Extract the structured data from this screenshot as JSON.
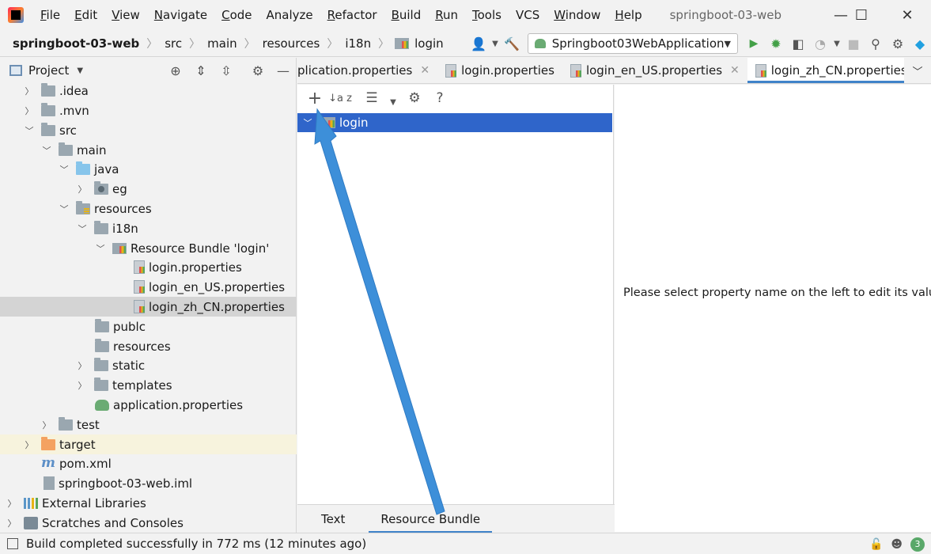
{
  "menubar": {
    "items": [
      {
        "label": "File",
        "mnemonic": "F",
        "rest": "ile"
      },
      {
        "label": "Edit",
        "mnemonic": "E",
        "rest": "dit"
      },
      {
        "label": "View",
        "mnemonic": "V",
        "rest": "iew"
      },
      {
        "label": "Navigate",
        "mnemonic": "N",
        "rest": "avigate"
      },
      {
        "label": "Code",
        "mnemonic": "C",
        "rest": "ode"
      },
      {
        "label": "Analyze",
        "mnemonic": "",
        "rest": "Analyze"
      },
      {
        "label": "Refactor",
        "mnemonic": "R",
        "rest": "efactor"
      },
      {
        "label": "Build",
        "mnemonic": "B",
        "rest": "uild"
      },
      {
        "label": "Run",
        "mnemonic": "R",
        "rest": "un"
      },
      {
        "label": "Tools",
        "mnemonic": "T",
        "rest": "ools"
      },
      {
        "label": "VCS",
        "mnemonic": "",
        "rest": "VCS"
      },
      {
        "label": "Window",
        "mnemonic": "W",
        "rest": "indow"
      },
      {
        "label": "Help",
        "mnemonic": "H",
        "rest": "elp"
      }
    ],
    "window_title": "springboot-03-web",
    "controls": {
      "minimize": "—",
      "maximize": "☐",
      "close": "✕"
    }
  },
  "navbar": {
    "breadcrumbs": [
      "springboot-03-web",
      "src",
      "main",
      "resources",
      "i18n",
      "login"
    ],
    "run_config": "Springboot03WebApplication"
  },
  "project_panel": {
    "title": "Project",
    "tree": [
      {
        "label": ".idea",
        "icon": "folder-icon",
        "expanded": false
      },
      {
        "label": ".mvn",
        "icon": "folder-icon",
        "expanded": false
      },
      {
        "label": "src",
        "icon": "folder-icon",
        "expanded": true
      },
      {
        "label": "main",
        "icon": "folder-icon",
        "expanded": true
      },
      {
        "label": "java",
        "icon": "source-folder-icon",
        "expanded": true
      },
      {
        "label": "eg",
        "icon": "package-icon",
        "expanded": false
      },
      {
        "label": "resources",
        "icon": "resources-folder-icon",
        "expanded": true
      },
      {
        "label": "i18n",
        "icon": "folder-icon",
        "expanded": true
      },
      {
        "label": "Resource Bundle 'login'",
        "icon": "resource-bundle-icon",
        "expanded": true
      },
      {
        "label": "login.properties",
        "icon": "properties-file-icon"
      },
      {
        "label": "login_en_US.properties",
        "icon": "properties-file-icon"
      },
      {
        "label": "login_zh_CN.properties",
        "icon": "properties-file-icon",
        "selected": true
      },
      {
        "label": "publc",
        "icon": "folder-icon"
      },
      {
        "label": "resources",
        "icon": "folder-icon"
      },
      {
        "label": "static",
        "icon": "folder-icon",
        "expanded": false
      },
      {
        "label": "templates",
        "icon": "folder-icon",
        "expanded": false
      },
      {
        "label": "application.properties",
        "icon": "spring-properties-icon"
      },
      {
        "label": "test",
        "icon": "folder-icon",
        "expanded": false
      },
      {
        "label": "target",
        "icon": "excluded-folder-icon",
        "expanded": false
      },
      {
        "label": "pom.xml",
        "icon": "maven-icon"
      },
      {
        "label": "springboot-03-web.iml",
        "icon": "iml-file-icon"
      },
      {
        "label": "External Libraries",
        "icon": "libraries-icon",
        "expanded": false
      },
      {
        "label": "Scratches and Consoles",
        "icon": "scratches-icon",
        "expanded": false
      }
    ]
  },
  "editor_tabs": [
    {
      "label": "plication.properties",
      "active": false
    },
    {
      "label": "login.properties",
      "active": false
    },
    {
      "label": "login_en_US.properties",
      "active": false
    },
    {
      "label": "login_zh_CN.properties",
      "active": true
    }
  ],
  "resource_bundle": {
    "toolbar": {
      "add": "+",
      "sort": "↓a z",
      "help": "?"
    },
    "tree_item": "login",
    "empty_message": "Please select property name on the left to edit its values"
  },
  "bottom_tabs": [
    {
      "label": "Text",
      "active": false
    },
    {
      "label": "Resource Bundle",
      "active": true
    }
  ],
  "statusbar": {
    "message": "Build completed successfully in 772 ms (12 minutes ago)",
    "event_count": "3"
  },
  "colors": {
    "accent": "#4083c9",
    "selection": "#2f65ca",
    "annotation_arrow": "#3d8fd9"
  }
}
